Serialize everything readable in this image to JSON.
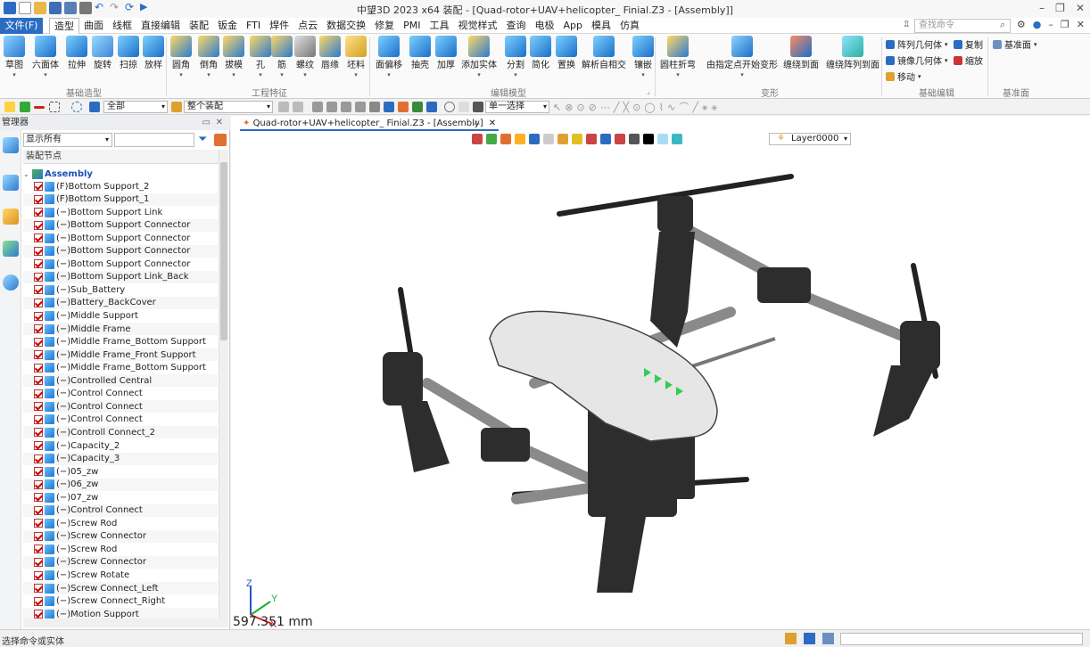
{
  "titlebar": {
    "title": "中望3D 2023 x64        装配 - [Quad-rotor+UAV+helicopter_ Finial.Z3 - [Assembly]]"
  },
  "menubar": {
    "file": "文件(F)",
    "tabs": [
      "造型",
      "曲面",
      "线框",
      "直接编辑",
      "装配",
      "钣金",
      "FTI",
      "焊件",
      "点云",
      "数据交换",
      "修复",
      "PMI",
      "工具",
      "视觉样式",
      "查询",
      "电极",
      "App",
      "模具",
      "仿真"
    ],
    "active_tab": "造型",
    "search_placeholder": "查找命令"
  },
  "ribbon": {
    "buttons": [
      "草图",
      "六面体",
      "拉伸",
      "旋转",
      "扫掠",
      "放样",
      "圆角",
      "倒角",
      "拔模",
      "孔",
      "筋",
      "螺纹",
      "唇缘",
      "坯料",
      "面偏移",
      "抽壳",
      "加厚",
      "添加实体",
      "分割",
      "简化",
      "置换",
      "解析自相交",
      "镶嵌",
      "圆柱折弯",
      "由指定点开始变形",
      "缠绕到面",
      "缠绕阵列到面"
    ],
    "groups": [
      "基础造型",
      "工程特征",
      "编辑模型",
      "变形",
      "基础编辑",
      "基准面"
    ],
    "small": {
      "pattern": "阵列几何体",
      "mirror": "镜像几何体",
      "move": "移动",
      "copy": "复制",
      "scale": "缩放",
      "datum": "基准面"
    }
  },
  "toolbar2": {
    "filter": "全部",
    "scope": "整个装配",
    "select_mode": "单一选择"
  },
  "manager": {
    "title": "管理器",
    "filter": "显示所有",
    "tree_header": "装配节点",
    "root": "Assembly",
    "items": [
      "(F)Bottom Support_2",
      "(F)Bottom Support_1",
      "(−)Bottom Support Link",
      "(−)Bottom Support Connector",
      "(−)Bottom Support Connector",
      "(−)Bottom Support Connector",
      "(−)Bottom Support Connector",
      "(−)Bottom Support Link_Back",
      "(−)Sub_Battery",
      "(−)Battery_BackCover",
      "(−)Middle Support",
      "(−)Middle Frame",
      "(−)Middle Frame_Bottom Support",
      "(−)Middle Frame_Front Support",
      "(−)Middle Frame_Bottom Support",
      "(−)Controlled Central",
      "(−)Control Connect",
      "(−)Control Connect",
      "(−)Control Connect",
      "(−)Controll Connect_2",
      "(−)Capacity_2",
      "(−)Capacity_3",
      "(−)05_zw",
      "(−)06_zw",
      "(−)07_zw",
      "(−)Control Connect",
      "(−)Screw Rod",
      "(−)Screw Connector",
      "(−)Screw Rod",
      "(−)Screw Connector",
      "(−)Screw Rotate",
      "(−)Screw Connect_Left",
      "(−)Screw Connect_Right",
      "(−)Motion Support"
    ]
  },
  "viewport": {
    "doc_tab": "Quad-rotor+UAV+helicopter_ Finial.Z3 - [Assembly]",
    "layer": "Layer0000",
    "scale": "597.351 mm"
  },
  "statusbar": {
    "prompt": "选择命令或实体"
  },
  "colors": {
    "accent": "#2b6cc2",
    "drone_body": "#2d2d2d",
    "drone_shell": "#e6e6e6",
    "arm": "#8a8a8a",
    "led": "#33cc55"
  }
}
